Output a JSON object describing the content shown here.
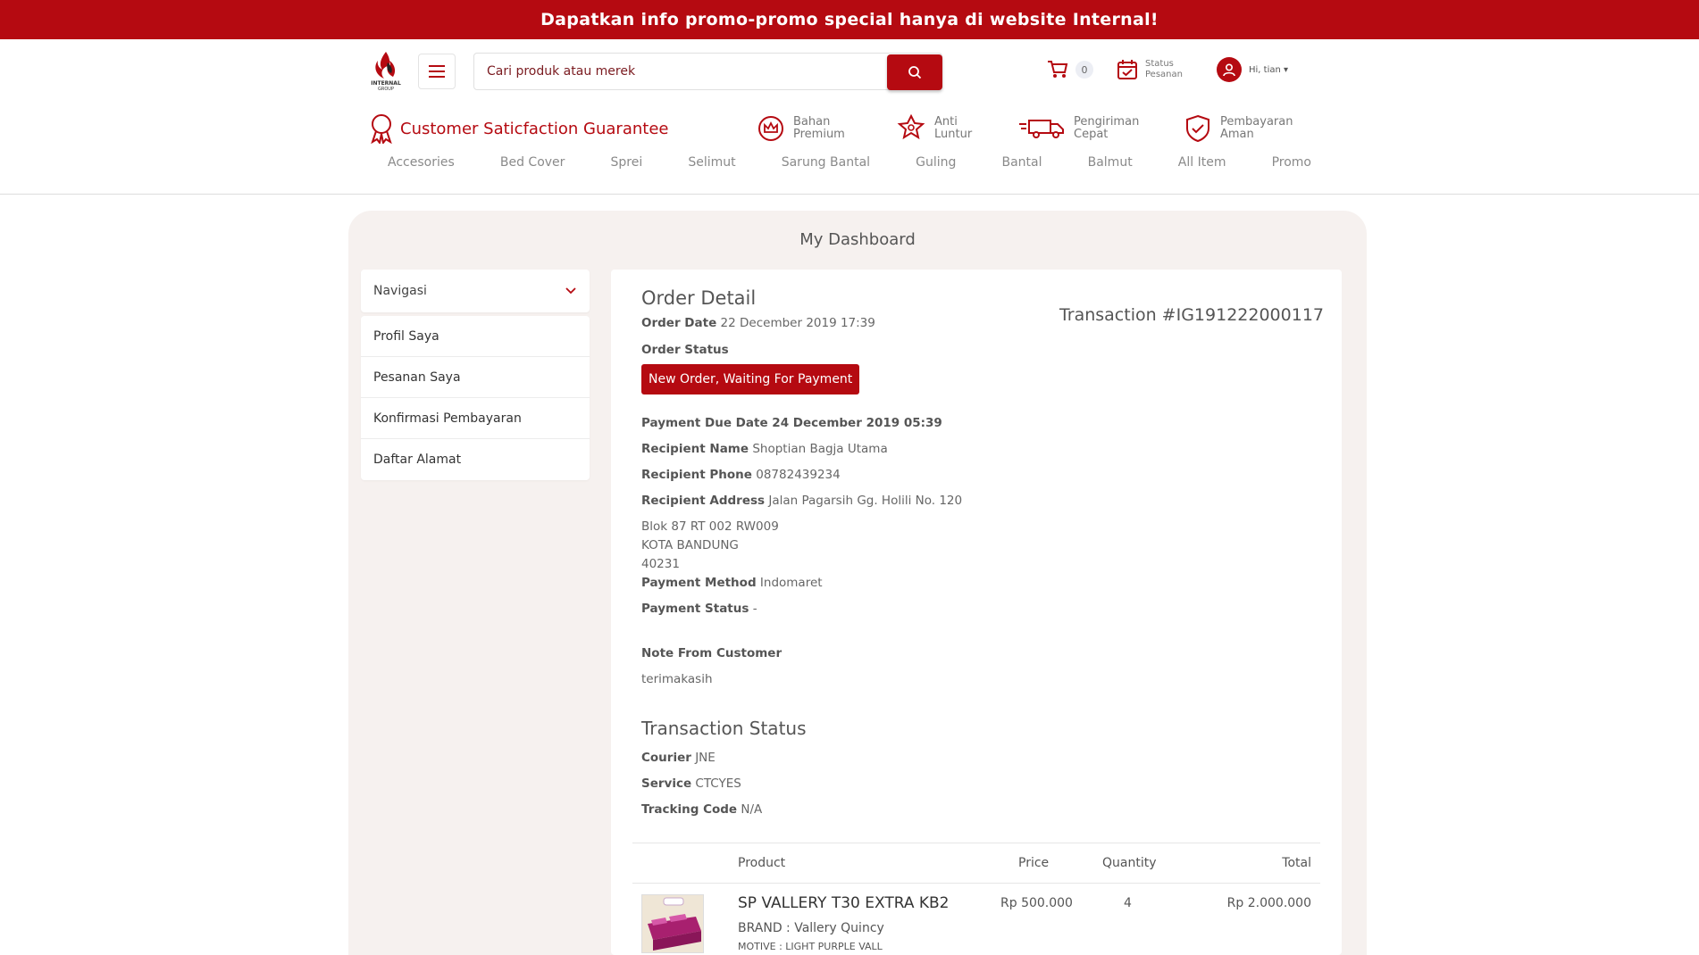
{
  "promo": {
    "text": "Dapatkan info promo-promo special hanya di website Internal!"
  },
  "header": {
    "logo_text": "INTERNAL",
    "logo_subtext": "GROUP",
    "search_placeholder": "Cari produk atau merek",
    "cart_count": "0",
    "status_line1": "Status",
    "status_line2": "Pesanan",
    "greeting": "Hi, tian ▾",
    "guarantee": "Customer Saticfaction Guarantee",
    "features": [
      {
        "line1": "Bahan",
        "line2": "Premium",
        "icon": "crown-icon"
      },
      {
        "line1": "Anti",
        "line2": "Luntur",
        "icon": "star-badge-icon"
      },
      {
        "line1": "Pengiriman",
        "line2": "Cepat",
        "icon": "truck-icon"
      },
      {
        "line1": "Pembayaran",
        "line2": "Aman",
        "icon": "shield-check-icon"
      }
    ],
    "categories": [
      "Accesories",
      "Bed Cover",
      "Sprei",
      "Selimut",
      "Sarung Bantal",
      "Guling",
      "Bantal",
      "Balmut",
      "All Item",
      "Promo"
    ]
  },
  "dashboard": {
    "title": "My Dashboard",
    "nav_title": "Navigasi",
    "nav_items": [
      "Profil Saya",
      "Pesanan Saya",
      "Konfirmasi Pembayaran",
      "Daftar Alamat"
    ]
  },
  "order": {
    "title": "Order Detail",
    "transaction": "Transaction #IG191222000117",
    "order_date_label": "Order Date",
    "order_date": "22 December 2019 17:39",
    "order_status_label": "Order Status",
    "status_badge": "New Order, Waiting For Payment",
    "due_label": "Payment Due Date 24 December 2019 05:39",
    "recipient_name_label": "Recipient Name",
    "recipient_name": "Shoptian Bagja Utama",
    "recipient_phone_label": "Recipient Phone",
    "recipient_phone": "08782439234",
    "recipient_address_label": "Recipient Address",
    "recipient_address": "Jalan Pagarsih Gg. Holili No. 120",
    "address_lines": [
      "Blok 87 RT 002 RW009",
      "KOTA BANDUNG",
      "40231"
    ],
    "payment_method_label": "Payment Method",
    "payment_method": "Indomaret",
    "payment_status_label": "Payment Status",
    "payment_status": "-",
    "note_label": "Note From Customer",
    "note": "terimakasih",
    "transaction_status_title": "Transaction Status",
    "courier_label": "Courier",
    "courier": "JNE",
    "service_label": "Service",
    "service": "CTCYES",
    "tracking_label": "Tracking Code",
    "tracking": "N/A"
  },
  "table": {
    "headers": {
      "product": "Product",
      "price": "Price",
      "quantity": "Quantity",
      "total": "Total"
    },
    "rows": [
      {
        "name": "SP VALLERY T30 EXTRA KB2",
        "brand": "BRAND : Vallery Quincy",
        "motive": "MOTIVE : LIGHT PURPLE VALL",
        "price": "Rp 500.000",
        "quantity": "4",
        "total": "Rp 2.000.000"
      }
    ]
  },
  "colors": {
    "brand": "#b50a11",
    "panel": "#f6f1ef"
  }
}
